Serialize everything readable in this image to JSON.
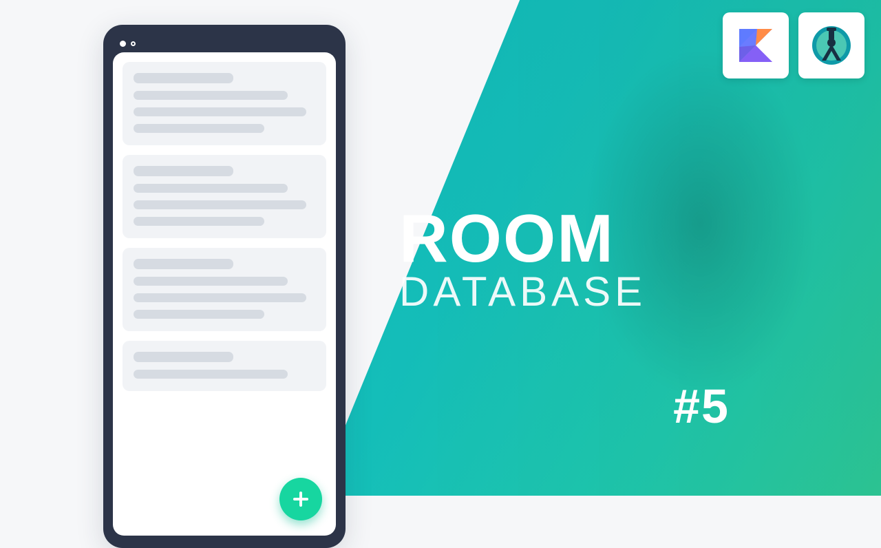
{
  "title": {
    "line1": "ROOM",
    "line2": "DATABASE"
  },
  "episode": "#5",
  "icons": {
    "kotlin": "kotlin-logo",
    "android_studio": "android-studio-logo"
  },
  "mockup": {
    "fab_label": "add"
  }
}
